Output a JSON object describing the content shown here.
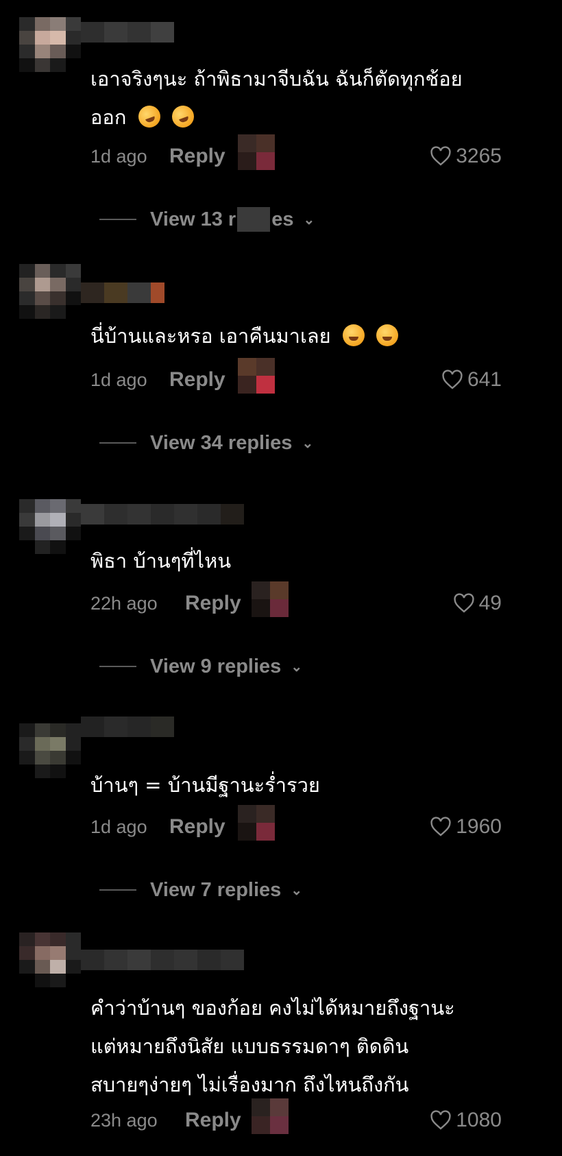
{
  "comments": [
    {
      "text_lines": [
        "เอาจริงๆนะ ถ้าพิธามาจีบฉัน ฉันก็ตัดทุกช้อย",
        "ออก"
      ],
      "emoji": [
        "rofl-emoji",
        "rofl-emoji"
      ],
      "time": "1d ago",
      "reply_label": "Reply",
      "likes": "3265",
      "view_replies": "View 13 r",
      "view_replies_tail": "es"
    },
    {
      "text_lines": [
        "นี่บ้านและหรอ เอาคืนมาเลย"
      ],
      "emoji": [
        "pleading-emoji",
        "pleading-emoji"
      ],
      "time": "1d ago",
      "reply_label": "Reply",
      "likes": "641",
      "view_replies": "View 34 replies"
    },
    {
      "text_lines": [
        "พิธา บ้านๆที่ไหน"
      ],
      "time": "22h ago",
      "reply_label": "Reply",
      "likes": "49",
      "view_replies": "View 9 replies"
    },
    {
      "text_lines": [
        "บ้านๆ = บ้านมีฐานะร่ำรวย"
      ],
      "time": "1d ago",
      "reply_label": "Reply",
      "likes": "1960",
      "view_replies": "View 7 replies"
    },
    {
      "text_lines": [
        "คำว่าบ้านๆ ของก้อย คงไม่ได้หมายถึงฐานะ",
        "แต่หมายถึงนิสัย แบบธรรมดาๆ ติดดิน",
        "สบายๆง่ายๆ ไม่เรื่องมาก ถึงไหนถึงกัน"
      ],
      "time": "23h ago",
      "reply_label": "Reply",
      "likes": "1080"
    }
  ],
  "icons": {
    "like": "heart-outline-icon",
    "expand": "chevron-down-icon"
  },
  "colors": {
    "background": "#000000",
    "muted": "#8a8a8a"
  }
}
